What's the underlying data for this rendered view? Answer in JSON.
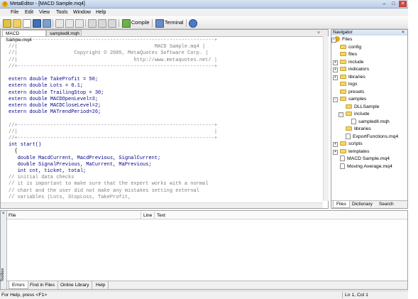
{
  "window": {
    "title": "MetaEditor - [MACD Sample.mq4]",
    "app_icon_glyph": "i",
    "controls": {
      "minimize": "–",
      "maximize": "□",
      "close": "✕"
    }
  },
  "menu": [
    "File",
    "Edit",
    "View",
    "Tools",
    "Window",
    "Help"
  ],
  "toolbar": {
    "compile_label": "Compile",
    "terminal_label": "Terminal"
  },
  "editor": {
    "tabs": [
      {
        "label": "MACD Sample.mq4",
        "active": true
      },
      {
        "label": "sampledll.mqh",
        "active": false
      }
    ],
    "close_glyph": "×",
    "code_lines": [
      "//+------------------------------------------------------------------+",
      "//|                                              MACD Sample.mq4 |",
      "//|                   Copyright © 2005, MetaQuotes Software Corp. |",
      "//|                                       http://www.metaquotes.net/ |",
      "//+------------------------------------------------------------------+",
      "",
      "extern double TakeProfit = 50;",
      "extern double Lots = 0.1;",
      "extern double TrailingStop = 30;",
      "extern double MACDOpenLevel=3;",
      "extern double MACDCloseLevel=2;",
      "extern double MATrendPeriod=26;",
      "",
      "//+------------------------------------------------------------------+",
      "//|                                                                  |",
      "//+------------------------------------------------------------------+",
      "int start()",
      "  {",
      "   double MacdCurrent, MacdPrevious, SignalCurrent;",
      "   double SignalPrevious, MaCurrent, MaPrevious;",
      "   int cnt, ticket, total;",
      "// initial data checks",
      "// it is important to make sure that the expert works with a normal",
      "// chart and the user did not make any mistakes setting external",
      "// variables (Lots, StopLoss, TakeProfit,"
    ]
  },
  "navigator": {
    "title": "Navigator",
    "close_glyph": "×",
    "tree": [
      {
        "label": "Files",
        "depth": 0,
        "kind": "root",
        "expander": "−"
      },
      {
        "label": "config",
        "depth": 1,
        "kind": "folder"
      },
      {
        "label": "files",
        "depth": 1,
        "kind": "folder"
      },
      {
        "label": "include",
        "depth": 1,
        "kind": "folder",
        "expander": "+"
      },
      {
        "label": "indicators",
        "depth": 1,
        "kind": "folder",
        "expander": "+"
      },
      {
        "label": "libraries",
        "depth": 1,
        "kind": "folder",
        "expander": "+"
      },
      {
        "label": "logs",
        "depth": 1,
        "kind": "folder"
      },
      {
        "label": "presets",
        "depth": 1,
        "kind": "folder"
      },
      {
        "label": "samples",
        "depth": 1,
        "kind": "folder",
        "expander": "−"
      },
      {
        "label": "DLLSample",
        "depth": 2,
        "kind": "folder"
      },
      {
        "label": "include",
        "depth": 2,
        "kind": "folder",
        "expander": "−"
      },
      {
        "label": "sampledll.mqh",
        "depth": 3,
        "kind": "file"
      },
      {
        "label": "libraries",
        "depth": 2,
        "kind": "folder"
      },
      {
        "label": "ExportFunctions.mq4",
        "depth": 2,
        "kind": "file"
      },
      {
        "label": "scripts",
        "depth": 1,
        "kind": "folder",
        "expander": "+"
      },
      {
        "label": "templates",
        "depth": 1,
        "kind": "folder",
        "expander": "+"
      },
      {
        "label": "MACD Sample.mq4",
        "depth": 1,
        "kind": "file"
      },
      {
        "label": "Moving Average.mq4",
        "depth": 1,
        "kind": "file"
      }
    ],
    "tabs": [
      {
        "label": "Files",
        "active": true
      },
      {
        "label": "Dictionary",
        "active": false
      },
      {
        "label": "Search",
        "active": false
      }
    ]
  },
  "toolbox": {
    "side_label": "Toolbox",
    "close_glyph": "×",
    "columns": [
      "File",
      "Line",
      "Text"
    ],
    "tabs": [
      {
        "label": "Errors",
        "active": true
      },
      {
        "label": "Find in Files",
        "active": false
      },
      {
        "label": "Online Library",
        "active": false
      },
      {
        "label": "Help",
        "active": false
      }
    ]
  },
  "statusbar": {
    "help_text": "For Help, press <F1>",
    "position": "Ln 1, Col 1"
  }
}
